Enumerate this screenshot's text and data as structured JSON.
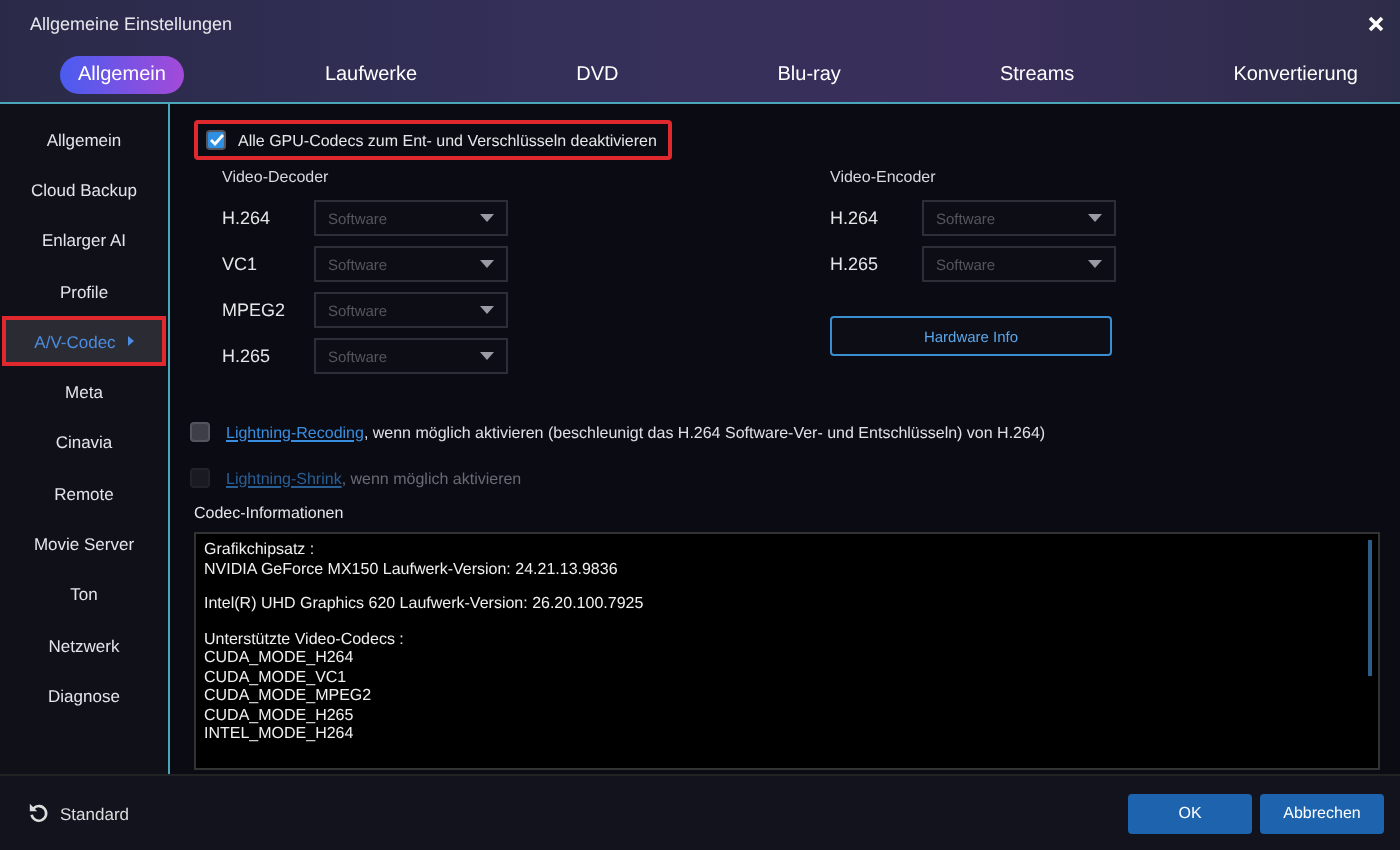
{
  "window": {
    "title": "Allgemeine Einstellungen"
  },
  "tabs": [
    {
      "label": "Allgemein",
      "selected": true
    },
    {
      "label": "Laufwerke",
      "selected": false
    },
    {
      "label": "DVD",
      "selected": false
    },
    {
      "label": "Blu-ray",
      "selected": false
    },
    {
      "label": "Streams",
      "selected": false
    },
    {
      "label": "Konvertierung",
      "selected": false
    }
  ],
  "sidebar": {
    "items": [
      {
        "label": "Allgemein",
        "selected": false
      },
      {
        "label": "Cloud Backup",
        "selected": false
      },
      {
        "label": "Enlarger AI",
        "selected": false
      },
      {
        "label": "Profile",
        "selected": false
      },
      {
        "label": "A/V-Codec",
        "selected": true
      },
      {
        "label": "Meta",
        "selected": false
      },
      {
        "label": "Cinavia",
        "selected": false
      },
      {
        "label": "Remote",
        "selected": false
      },
      {
        "label": "Movie Server",
        "selected": false
      },
      {
        "label": "Ton",
        "selected": false
      },
      {
        "label": "Netzwerk",
        "selected": false
      },
      {
        "label": "Diagnose",
        "selected": false
      }
    ]
  },
  "gpu_option": {
    "label": "Alle GPU-Codecs zum Ent- und Verschlüsseln deaktivieren",
    "checked": true
  },
  "decoder": {
    "title": "Video-Decoder",
    "rows": [
      {
        "label": "H.264",
        "value": "Software"
      },
      {
        "label": "VC1",
        "value": "Software"
      },
      {
        "label": "MPEG2",
        "value": "Software"
      },
      {
        "label": "H.265",
        "value": "Software"
      }
    ]
  },
  "encoder": {
    "title": "Video-Encoder",
    "rows": [
      {
        "label": "H.264",
        "value": "Software"
      },
      {
        "label": "H.265",
        "value": "Software"
      }
    ]
  },
  "hardware_button": "Hardware Info",
  "options": [
    {
      "link": "Lightning-Recoding",
      "text": ", wenn möglich aktivieren (beschleunigt das H.264 Software-Ver- und Entschlüsseln) von H.264)",
      "checked": false,
      "disabled": false
    },
    {
      "link": "Lightning-Shrink",
      "text": ", wenn möglich aktivieren",
      "checked": false,
      "disabled": true
    }
  ],
  "codec_info": {
    "title": "Codec-Informationen",
    "paragraphs": [
      [
        "Grafikchipsatz :",
        "NVIDIA GeForce MX150 Laufwerk-Version: 24.21.13.9836"
      ],
      [
        "Intel(R) UHD Graphics 620 Laufwerk-Version: 26.20.100.7925"
      ],
      [
        "Unterstützte Video-Codecs :",
        "CUDA_MODE_H264",
        "CUDA_MODE_VC1",
        "CUDA_MODE_MPEG2",
        "CUDA_MODE_H265",
        "INTEL_MODE_H264"
      ]
    ]
  },
  "footer": {
    "reset": "Standard",
    "ok": "OK",
    "cancel": "Abbrechen"
  }
}
